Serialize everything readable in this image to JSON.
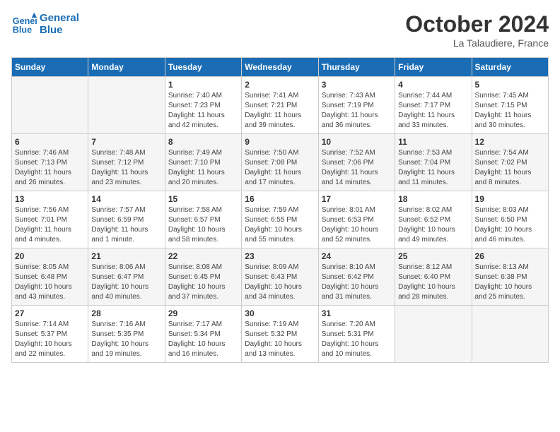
{
  "header": {
    "logo_line1": "General",
    "logo_line2": "Blue",
    "month": "October 2024",
    "location": "La Talaudiere, France"
  },
  "weekdays": [
    "Sunday",
    "Monday",
    "Tuesday",
    "Wednesday",
    "Thursday",
    "Friday",
    "Saturday"
  ],
  "weeks": [
    [
      {
        "day": "",
        "info": ""
      },
      {
        "day": "",
        "info": ""
      },
      {
        "day": "1",
        "info": "Sunrise: 7:40 AM\nSunset: 7:23 PM\nDaylight: 11 hours\nand 42 minutes."
      },
      {
        "day": "2",
        "info": "Sunrise: 7:41 AM\nSunset: 7:21 PM\nDaylight: 11 hours\nand 39 minutes."
      },
      {
        "day": "3",
        "info": "Sunrise: 7:43 AM\nSunset: 7:19 PM\nDaylight: 11 hours\nand 36 minutes."
      },
      {
        "day": "4",
        "info": "Sunrise: 7:44 AM\nSunset: 7:17 PM\nDaylight: 11 hours\nand 33 minutes."
      },
      {
        "day": "5",
        "info": "Sunrise: 7:45 AM\nSunset: 7:15 PM\nDaylight: 11 hours\nand 30 minutes."
      }
    ],
    [
      {
        "day": "6",
        "info": "Sunrise: 7:46 AM\nSunset: 7:13 PM\nDaylight: 11 hours\nand 26 minutes."
      },
      {
        "day": "7",
        "info": "Sunrise: 7:48 AM\nSunset: 7:12 PM\nDaylight: 11 hours\nand 23 minutes."
      },
      {
        "day": "8",
        "info": "Sunrise: 7:49 AM\nSunset: 7:10 PM\nDaylight: 11 hours\nand 20 minutes."
      },
      {
        "day": "9",
        "info": "Sunrise: 7:50 AM\nSunset: 7:08 PM\nDaylight: 11 hours\nand 17 minutes."
      },
      {
        "day": "10",
        "info": "Sunrise: 7:52 AM\nSunset: 7:06 PM\nDaylight: 11 hours\nand 14 minutes."
      },
      {
        "day": "11",
        "info": "Sunrise: 7:53 AM\nSunset: 7:04 PM\nDaylight: 11 hours\nand 11 minutes."
      },
      {
        "day": "12",
        "info": "Sunrise: 7:54 AM\nSunset: 7:02 PM\nDaylight: 11 hours\nand 8 minutes."
      }
    ],
    [
      {
        "day": "13",
        "info": "Sunrise: 7:56 AM\nSunset: 7:01 PM\nDaylight: 11 hours\nand 4 minutes."
      },
      {
        "day": "14",
        "info": "Sunrise: 7:57 AM\nSunset: 6:59 PM\nDaylight: 11 hours\nand 1 minute."
      },
      {
        "day": "15",
        "info": "Sunrise: 7:58 AM\nSunset: 6:57 PM\nDaylight: 10 hours\nand 58 minutes."
      },
      {
        "day": "16",
        "info": "Sunrise: 7:59 AM\nSunset: 6:55 PM\nDaylight: 10 hours\nand 55 minutes."
      },
      {
        "day": "17",
        "info": "Sunrise: 8:01 AM\nSunset: 6:53 PM\nDaylight: 10 hours\nand 52 minutes."
      },
      {
        "day": "18",
        "info": "Sunrise: 8:02 AM\nSunset: 6:52 PM\nDaylight: 10 hours\nand 49 minutes."
      },
      {
        "day": "19",
        "info": "Sunrise: 8:03 AM\nSunset: 6:50 PM\nDaylight: 10 hours\nand 46 minutes."
      }
    ],
    [
      {
        "day": "20",
        "info": "Sunrise: 8:05 AM\nSunset: 6:48 PM\nDaylight: 10 hours\nand 43 minutes."
      },
      {
        "day": "21",
        "info": "Sunrise: 8:06 AM\nSunset: 6:47 PM\nDaylight: 10 hours\nand 40 minutes."
      },
      {
        "day": "22",
        "info": "Sunrise: 8:08 AM\nSunset: 6:45 PM\nDaylight: 10 hours\nand 37 minutes."
      },
      {
        "day": "23",
        "info": "Sunrise: 8:09 AM\nSunset: 6:43 PM\nDaylight: 10 hours\nand 34 minutes."
      },
      {
        "day": "24",
        "info": "Sunrise: 8:10 AM\nSunset: 6:42 PM\nDaylight: 10 hours\nand 31 minutes."
      },
      {
        "day": "25",
        "info": "Sunrise: 8:12 AM\nSunset: 6:40 PM\nDaylight: 10 hours\nand 28 minutes."
      },
      {
        "day": "26",
        "info": "Sunrise: 8:13 AM\nSunset: 6:38 PM\nDaylight: 10 hours\nand 25 minutes."
      }
    ],
    [
      {
        "day": "27",
        "info": "Sunrise: 7:14 AM\nSunset: 5:37 PM\nDaylight: 10 hours\nand 22 minutes."
      },
      {
        "day": "28",
        "info": "Sunrise: 7:16 AM\nSunset: 5:35 PM\nDaylight: 10 hours\nand 19 minutes."
      },
      {
        "day": "29",
        "info": "Sunrise: 7:17 AM\nSunset: 5:34 PM\nDaylight: 10 hours\nand 16 minutes."
      },
      {
        "day": "30",
        "info": "Sunrise: 7:19 AM\nSunset: 5:32 PM\nDaylight: 10 hours\nand 13 minutes."
      },
      {
        "day": "31",
        "info": "Sunrise: 7:20 AM\nSunset: 5:31 PM\nDaylight: 10 hours\nand 10 minutes."
      },
      {
        "day": "",
        "info": ""
      },
      {
        "day": "",
        "info": ""
      }
    ]
  ]
}
